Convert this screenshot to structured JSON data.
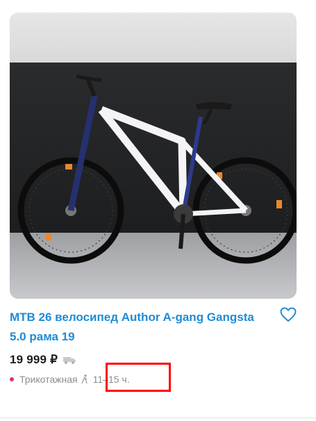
{
  "listing": {
    "title": "МТВ 26 велосипед Author A-gang Gangsta 5.0 рама 19",
    "price": "19 999 ₽",
    "metro_station": "Трикотажная",
    "delivery_time": "11–15 ч.",
    "metro_line_color": "#d8345f",
    "title_color": "#1f8bd6"
  },
  "icons": {
    "favorite": "heart-outline-icon",
    "delivery": "truck-icon",
    "distance": "walking-person-icon"
  }
}
